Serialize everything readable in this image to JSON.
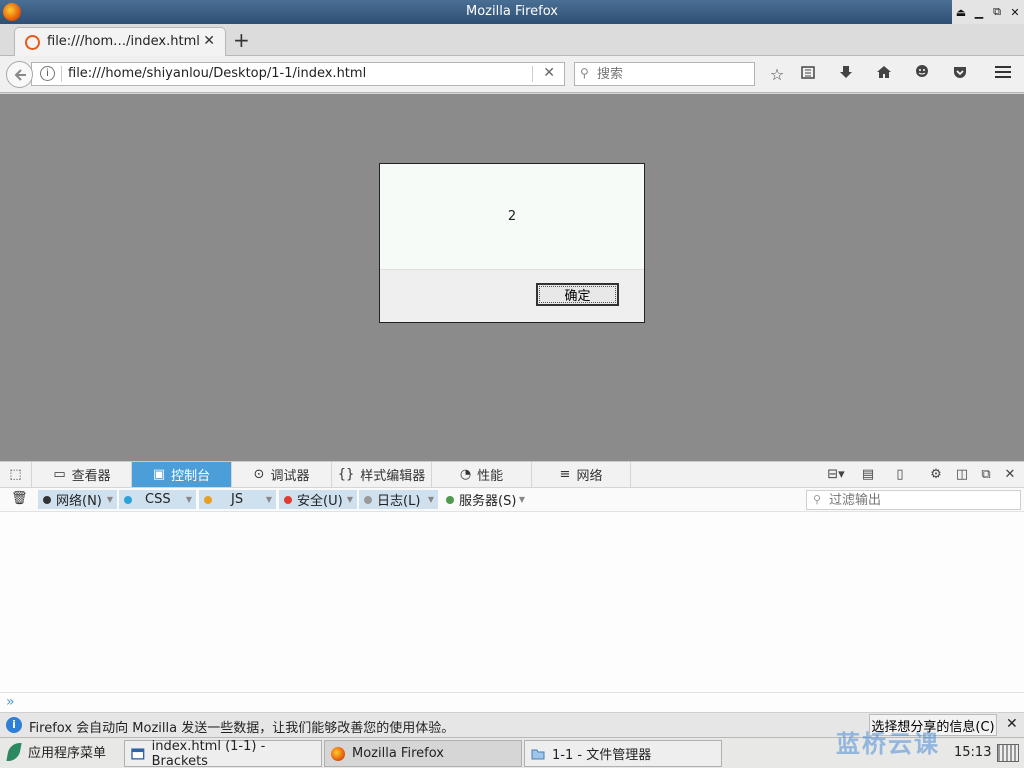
{
  "window": {
    "title": "Mozilla Firefox"
  },
  "tab": {
    "title": "file:///hom…/index.html"
  },
  "navbar": {
    "url": "file:///home/shiyanlou/Desktop/1-1/index.html",
    "search_placeholder": "搜索"
  },
  "dialog": {
    "message": "2",
    "ok_label": "确定"
  },
  "devtools": {
    "tabs": [
      {
        "label": "查看器",
        "icon": "inspector-icon"
      },
      {
        "label": "控制台",
        "icon": "console-icon"
      },
      {
        "label": "调试器",
        "icon": "debugger-icon"
      },
      {
        "label": "样式编辑器",
        "icon": "style-editor-icon"
      },
      {
        "label": "性能",
        "icon": "performance-icon"
      },
      {
        "label": "网络",
        "icon": "network-icon"
      }
    ],
    "filters": [
      {
        "label": "网络(N)",
        "color": "#333333"
      },
      {
        "label": "CSS",
        "color": "#29a3d9"
      },
      {
        "label": "JS",
        "color": "#e8a023"
      },
      {
        "label": "安全(U)",
        "color": "#e03b2f"
      },
      {
        "label": "日志(L)",
        "color": "#9a9a9a"
      },
      {
        "label": "服务器(S)",
        "color": "#4f9a4f"
      }
    ],
    "filter_output_placeholder": "过滤输出"
  },
  "notification": {
    "text": "Firefox 会自动向 Mozilla 发送一些数据，让我们能够改善您的使用体验。",
    "button": "选择想分享的信息(C)"
  },
  "taskbar": {
    "menu": "应用程序菜单",
    "tasks": [
      "index.html (1-1) - Brackets",
      "Mozilla Firefox",
      "1-1 - 文件管理器"
    ],
    "clock": "15:13",
    "watermark": "蓝桥云课"
  }
}
